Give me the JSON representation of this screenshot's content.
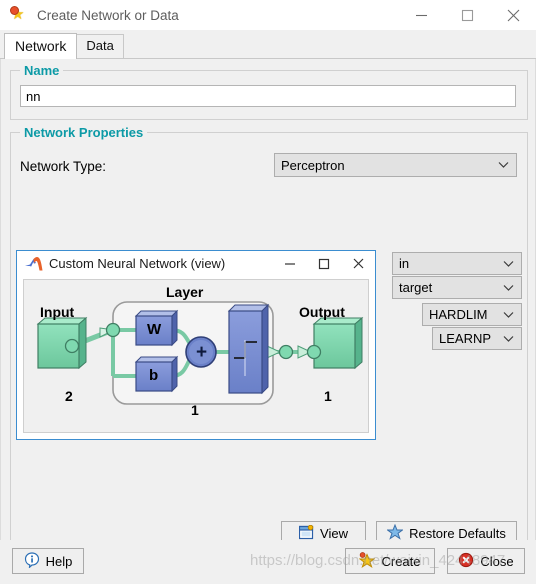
{
  "window": {
    "title": "Create Network or Data",
    "icon": "star-icon",
    "controls": {
      "minimize": "minimize-icon",
      "maximize": "maximize-icon",
      "close": "close-icon"
    }
  },
  "tabs": [
    {
      "label": "Network",
      "active": true
    },
    {
      "label": "Data",
      "active": false
    }
  ],
  "name_group": {
    "title": "Name",
    "value": "nn",
    "placeholder": ""
  },
  "network_properties": {
    "title": "Network Properties",
    "network_type_label": "Network Type:",
    "network_type_value": "Perceptron",
    "side_combos": [
      {
        "name": "input-data",
        "value": "in"
      },
      {
        "name": "target-data",
        "value": "target"
      },
      {
        "name": "transfer-function",
        "value": "HARDLIM"
      },
      {
        "name": "learning-function",
        "value": "LEARNP"
      }
    ],
    "buttons": {
      "view": "View",
      "restore_defaults": "Restore Defaults"
    }
  },
  "view_window": {
    "title": "Custom Neural Network (view)",
    "icon": "matlab-icon",
    "controls": {
      "minimize": "minimize-icon",
      "maximize": "maximize-icon",
      "close": "close-icon"
    },
    "diagram": {
      "input_label": "Input",
      "input_size": "2",
      "layer_label": "Layer",
      "layer_size": "1",
      "output_label": "Output",
      "output_size": "1",
      "weight_label": "W",
      "bias_label": "b",
      "sum_label": "+",
      "transfer_glyph": "hardlim-step-icon"
    }
  },
  "footer": {
    "help": "Help",
    "create": "Create",
    "close": "Close"
  },
  "watermark": {
    "text": "https://blog.csdn.net/weixin_42448947"
  },
  "colors": {
    "group_title": "#0c9aa6",
    "view_window_border": "#3b8dd0",
    "node_green": "#7fd9b0",
    "node_blue": "#7b8fd4",
    "title_text": "#5d5d5d"
  }
}
